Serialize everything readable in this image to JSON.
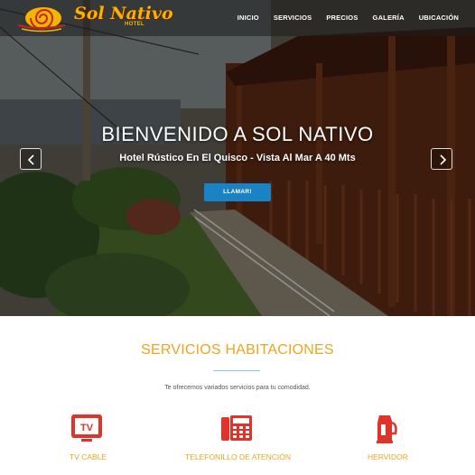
{
  "brand": {
    "name": "Sol Nativo",
    "tagline": "HOTEL",
    "color": "#f5b400"
  },
  "nav": {
    "items": [
      {
        "label": "INICIO"
      },
      {
        "label": "SERVICIOS"
      },
      {
        "label": "PRECIOS"
      },
      {
        "label": "GALERÍA"
      },
      {
        "label": "UBICACIÓN"
      }
    ]
  },
  "hero": {
    "title": "BIENVENIDO A SOL NATIVO",
    "subtitle": "Hotel Rústico En El Quisco - Vista Al Mar A 40 Mts",
    "button_label": "LLAMAR!",
    "button_color": "#1a83c6",
    "prev_icon": "chevron-left-icon",
    "next_icon": "chevron-right-icon"
  },
  "services": {
    "title": "SERVICIOS HABITACIONES",
    "description": "Te ofrecemos variados servicios para tu comodidad.",
    "accent_color": "#f0a41e",
    "icon_color": "#e0342b",
    "items": [
      {
        "label": "TV CABLE",
        "icon": "tv-icon"
      },
      {
        "label": "TELEFONILLO DE ATENCIÓN",
        "icon": "phone-icon"
      },
      {
        "label": "HERVIDOR",
        "icon": "kettle-icon"
      }
    ]
  }
}
